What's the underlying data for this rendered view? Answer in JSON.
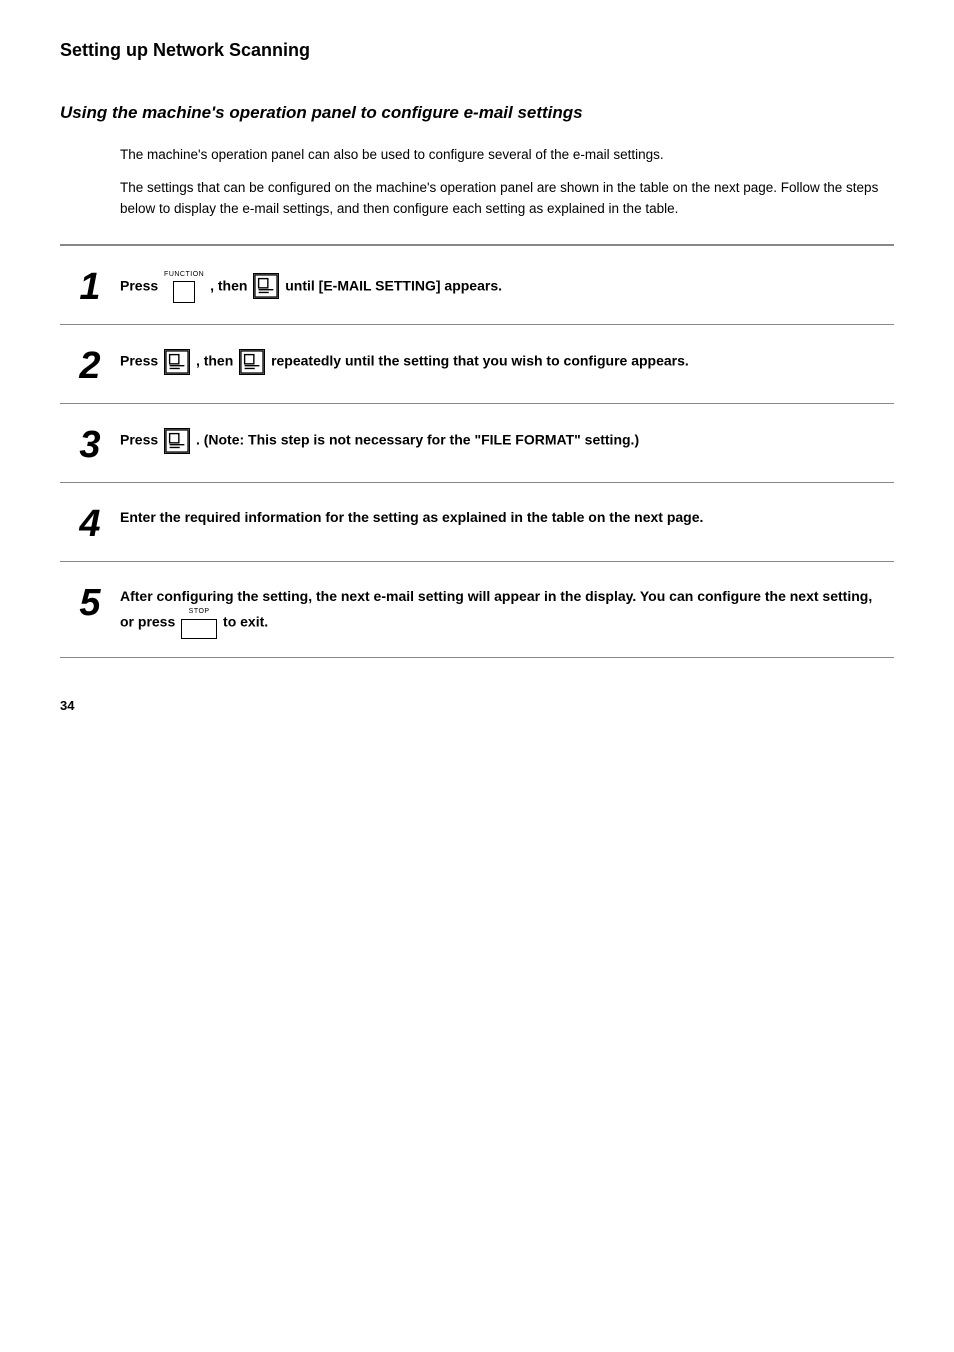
{
  "page": {
    "title": "Setting up Network Scanning",
    "page_number": "34"
  },
  "section": {
    "title": "Using the machine's operation panel to configure e-mail settings",
    "intro1": "The machine's operation panel can also be used to configure several of the e-mail settings.",
    "intro2": "The settings that can be configured on the machine's operation panel are shown in the table on the next page. Follow the steps below to display the e-mail settings, and then configure each setting as explained in the table."
  },
  "steps": [
    {
      "num": "1",
      "text_parts": [
        "Press",
        "FUNCTION",
        "then",
        "panel1",
        "until [E-MAIL SETTING] appears."
      ]
    },
    {
      "num": "2",
      "text_parts": [
        "Press",
        "panel2",
        "then",
        "panel3",
        "repeatedly until the setting that you wish to configure appears."
      ]
    },
    {
      "num": "3",
      "text_parts": [
        "Press",
        "panel4",
        ". (Note: This step is not necessary for the “FILE FORMAT” setting.)"
      ]
    },
    {
      "num": "4",
      "text_parts": [
        "Enter the required information for the setting as explained in the table on the next page."
      ]
    },
    {
      "num": "5",
      "text_parts": [
        "After configuring the setting, the next e-mail setting will appear in the display. You can configure the next setting, or press",
        "STOP",
        "to exit."
      ]
    }
  ]
}
